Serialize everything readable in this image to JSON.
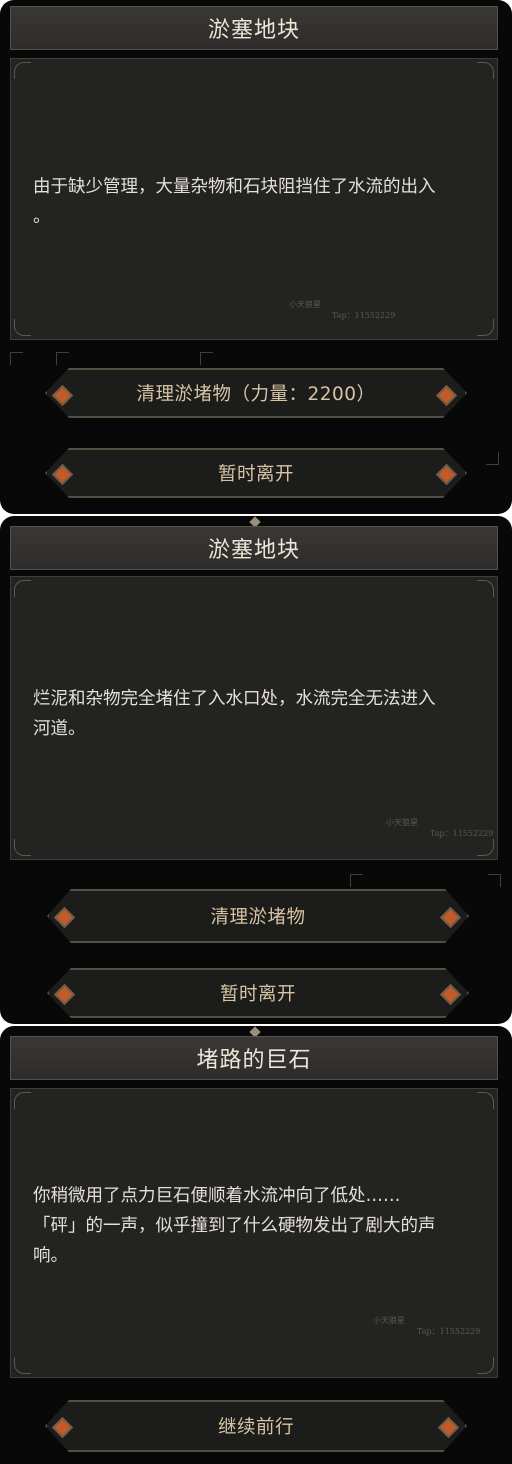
{
  "panels": [
    {
      "title": "淤塞地块",
      "description": "由于缺少管理，大量杂物和石块阻挡住了水流的出入\n。",
      "watermark": {
        "name": "小天狼星",
        "tap": "Tap：11552229"
      },
      "buttons": [
        {
          "label": "清理淤堵物（力量：2200）"
        },
        {
          "label": "暂时离开"
        }
      ]
    },
    {
      "title": "淤塞地块",
      "description": "烂泥和杂物完全堵住了入水口处，水流完全无法进入\n河道。",
      "watermark": {
        "name": "小天狼星",
        "tap": "Tap：11552229"
      },
      "buttons": [
        {
          "label": "清理淤堵物"
        },
        {
          "label": "暂时离开"
        }
      ]
    },
    {
      "title": "堵路的巨石",
      "description": "你稍微用了点力巨石便顺着水流冲向了低处……\n「砰」的一声，似乎撞到了什么硬物发出了剧大的声\n响。",
      "watermark": {
        "name": "小天狼星",
        "tap": "Tap：11552229"
      },
      "buttons": [
        {
          "label": "继续前行"
        }
      ]
    }
  ],
  "colors": {
    "panel_bg": "#080808",
    "content_bg": "#232322",
    "title_text": "#ece6da",
    "button_text": "#d8c4a4",
    "button_gem": "#c25a2a"
  },
  "icons": [
    "diamond-ornament-icon",
    "button-gem-icon"
  ]
}
